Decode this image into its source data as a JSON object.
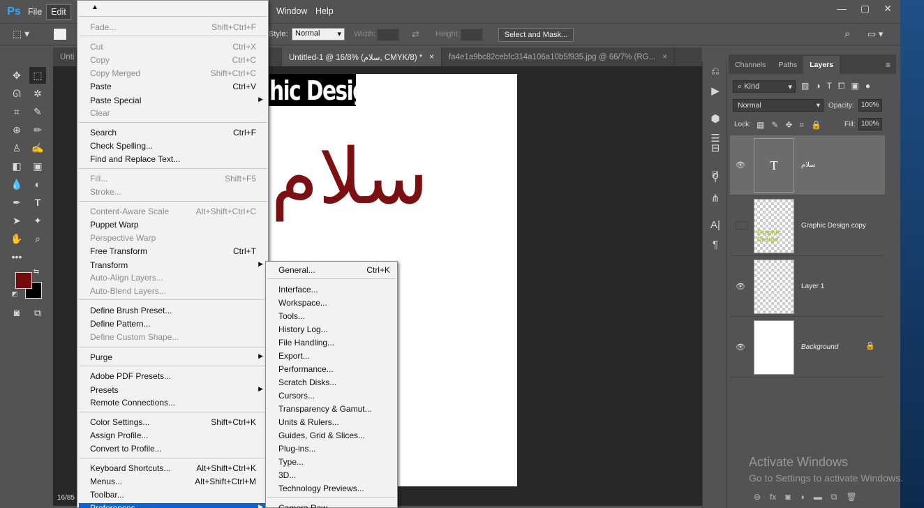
{
  "app": {
    "logo": "Ps",
    "menus": [
      "File",
      "Edit",
      "Window",
      "Help"
    ],
    "active_menu": "Edit",
    "window_controls": [
      "—",
      "▢",
      "✕"
    ]
  },
  "options_bar": {
    "style_label": "Style:",
    "style_value": "Normal",
    "width_label": "Width:",
    "height_label": "Height:",
    "select_mask": "Select and Mask..."
  },
  "tabs": [
    {
      "label": "Unti",
      "close": ""
    },
    {
      "label": "Untitled-1 @ 16/8% (سلام, CMYK/8) *",
      "close": "×"
    },
    {
      "label": "fa4e1a9bc82cebfc314a106a10b5f935.jpg @ 66/7% (RG...",
      "close": "×"
    }
  ],
  "canvas": {
    "heading_text": "hic Design",
    "arabic_text": "سلام",
    "zoom": "16/85"
  },
  "edit_menu": {
    "items": [
      {
        "label": "Fade...",
        "shortcut": "Shift+Ctrl+F",
        "disabled": true
      },
      {
        "label": "Cut",
        "shortcut": "Ctrl+X",
        "disabled": true
      },
      {
        "label": "Copy",
        "shortcut": "Ctrl+C",
        "disabled": true
      },
      {
        "label": "Copy Merged",
        "shortcut": "Shift+Ctrl+C",
        "disabled": true
      },
      {
        "label": "Paste",
        "shortcut": "Ctrl+V",
        "disabled": false
      },
      {
        "label": "Paste Special",
        "shortcut": "",
        "disabled": false
      },
      {
        "label": "Clear",
        "shortcut": "",
        "disabled": true
      },
      {
        "label": "Search",
        "shortcut": "Ctrl+F",
        "disabled": false
      },
      {
        "label": "Check Spelling...",
        "shortcut": "",
        "disabled": false
      },
      {
        "label": "Find and Replace Text...",
        "shortcut": "",
        "disabled": false
      },
      {
        "label": "Fill...",
        "shortcut": "Shift+F5",
        "disabled": true
      },
      {
        "label": "Stroke...",
        "shortcut": "",
        "disabled": true
      },
      {
        "label": "Content-Aware Scale",
        "shortcut": "Alt+Shift+Ctrl+C",
        "disabled": true
      },
      {
        "label": "Puppet Warp",
        "shortcut": "",
        "disabled": false
      },
      {
        "label": "Perspective Warp",
        "shortcut": "",
        "disabled": true
      },
      {
        "label": "Free Transform",
        "shortcut": "Ctrl+T",
        "disabled": false
      },
      {
        "label": "Transform",
        "shortcut": "",
        "disabled": false
      },
      {
        "label": "Auto-Align Layers...",
        "shortcut": "",
        "disabled": true
      },
      {
        "label": "Auto-Blend Layers...",
        "shortcut": "",
        "disabled": true
      },
      {
        "label": "Define Brush Preset...",
        "shortcut": "",
        "disabled": false
      },
      {
        "label": "Define Pattern...",
        "shortcut": "",
        "disabled": false
      },
      {
        "label": "Define Custom Shape...",
        "shortcut": "",
        "disabled": true
      },
      {
        "label": "Purge",
        "shortcut": "",
        "disabled": false
      },
      {
        "label": "Adobe PDF Presets...",
        "shortcut": "",
        "disabled": false
      },
      {
        "label": "Presets",
        "shortcut": "",
        "disabled": false
      },
      {
        "label": "Remote Connections...",
        "shortcut": "",
        "disabled": false
      },
      {
        "label": "Color Settings...",
        "shortcut": "Shift+Ctrl+K",
        "disabled": false
      },
      {
        "label": "Assign Profile...",
        "shortcut": "",
        "disabled": false
      },
      {
        "label": "Convert to Profile...",
        "shortcut": "",
        "disabled": false
      },
      {
        "label": "Keyboard Shortcuts...",
        "shortcut": "Alt+Shift+Ctrl+K",
        "disabled": false
      },
      {
        "label": "Menus...",
        "shortcut": "Alt+Shift+Ctrl+M",
        "disabled": false
      },
      {
        "label": "Toolbar...",
        "shortcut": "",
        "disabled": false
      },
      {
        "label": "Preferences",
        "shortcut": "",
        "disabled": false,
        "highlighted": true
      }
    ]
  },
  "preferences_submenu": {
    "items": [
      {
        "label": "General...",
        "shortcut": "Ctrl+K"
      },
      {
        "label": "Interface...",
        "shortcut": ""
      },
      {
        "label": "Workspace...",
        "shortcut": ""
      },
      {
        "label": "Tools...",
        "shortcut": ""
      },
      {
        "label": "History Log...",
        "shortcut": ""
      },
      {
        "label": "File Handling...",
        "shortcut": ""
      },
      {
        "label": "Export...",
        "shortcut": ""
      },
      {
        "label": "Performance...",
        "shortcut": ""
      },
      {
        "label": "Scratch Disks...",
        "shortcut": ""
      },
      {
        "label": "Cursors...",
        "shortcut": ""
      },
      {
        "label": "Transparency & Gamut...",
        "shortcut": ""
      },
      {
        "label": "Units & Rulers...",
        "shortcut": ""
      },
      {
        "label": "Guides, Grid & Slices...",
        "shortcut": ""
      },
      {
        "label": "Plug-ins...",
        "shortcut": ""
      },
      {
        "label": "Type...",
        "shortcut": ""
      },
      {
        "label": "3D...",
        "shortcut": ""
      },
      {
        "label": "Technology Previews...",
        "shortcut": ""
      },
      {
        "label": "Camera Raw...",
        "shortcut": ""
      }
    ]
  },
  "layers_panel": {
    "tabs": [
      "Channels",
      "Paths",
      "Layers"
    ],
    "active_tab": "Layers",
    "kind_label": "Kind",
    "blend_mode": "Normal",
    "opacity_label": "Opacity:",
    "opacity_value": "100%",
    "lock_label": "Lock:",
    "fill_label": "Fill:",
    "fill_value": "100%",
    "layers": [
      {
        "name": "سلام",
        "type": "text",
        "visible": true,
        "selected": true,
        "thumb_label": "T"
      },
      {
        "name": "Graphic Design copy",
        "type": "raster",
        "visible": false,
        "selected": false,
        "thumb_label": "Graphic Design"
      },
      {
        "name": "Layer 1",
        "type": "raster",
        "visible": true,
        "selected": false
      },
      {
        "name": "Background",
        "type": "background",
        "visible": true,
        "selected": false,
        "locked": true
      }
    ]
  },
  "colors": {
    "foreground": "#750a0a",
    "background": "#000000",
    "menu_highlight": "#0a64c9"
  },
  "watermark": {
    "line1": "Activate Windows",
    "line2": "Go to Settings to activate Windows."
  }
}
